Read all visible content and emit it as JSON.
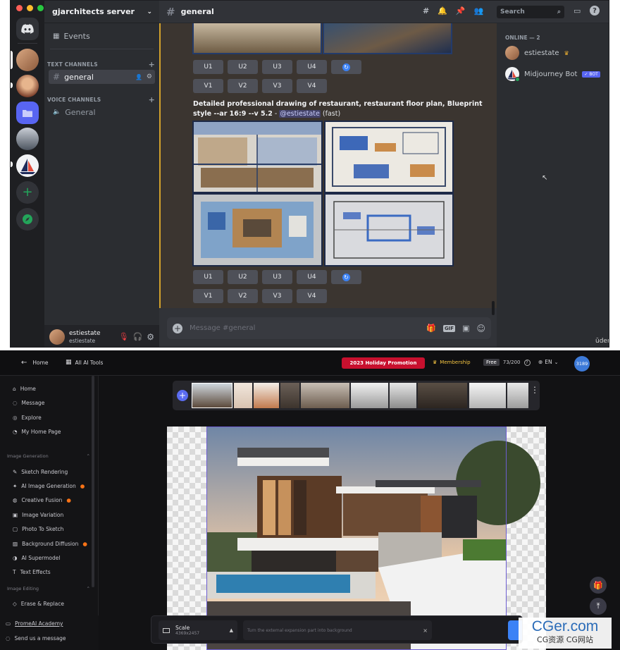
{
  "discord": {
    "server_name": "gjarchitects server",
    "channel_header": "general",
    "search_placeholder": "Search",
    "events_label": "Events",
    "text_channels_label": "TEXT CHANNELS",
    "voice_channels_label": "VOICE CHANNELS",
    "text_channel": "general",
    "voice_channel": "General",
    "upscale_buttons": [
      "U1",
      "U2",
      "U3",
      "U4"
    ],
    "variation_buttons": [
      "V1",
      "V2",
      "V3",
      "V4"
    ],
    "prompt_bold": "Detailed professional drawing of restaurant, restaurant floor plan, Blueprint style --ar 16:9 --v 5.2",
    "prompt_sep": " - ",
    "prompt_mention": "@estiestate",
    "prompt_mode": " (fast)",
    "message_placeholder": "Message #general",
    "members_header": "ONLINE — 2",
    "members": [
      "estiestate",
      "Midjourney Bot"
    ],
    "bot_badge": "✓ BOT",
    "user_name": "estiestate",
    "user_tag": "estiestate",
    "watermark": "ūdemy",
    "gif_label": "GIF",
    "colors": {
      "bg": "#313338",
      "sidebar": "#2b2d31",
      "accent": "#5865f2",
      "highlight_border": "#d3a22c"
    }
  },
  "prome": {
    "home_link": "Home",
    "all_tools": "All AI Tools",
    "promo": "2023 Holiday Promotion",
    "membership": "Membership",
    "plan_badge": "Free",
    "credits": "73/200",
    "language": "EN",
    "user_badge": "3189",
    "nav": [
      "Home",
      "Message",
      "Explore",
      "My Home Page"
    ],
    "image_generation_label": "Image Generation",
    "image_generation": [
      "Sketch Rendering",
      "AI Image Generation",
      "Creative Fusion",
      "Image Variation",
      "Photo To Sketch",
      "Background Diffusion",
      "AI Supermodel",
      "Text Effects"
    ],
    "hot_items": [
      false,
      true,
      true,
      false,
      false,
      true,
      false,
      false
    ],
    "image_editing_label": "Image Editing",
    "image_editing": [
      "Erase & Replace"
    ],
    "academy": "PromeAI Academy",
    "send_message": "Send us a message",
    "scale_label": "Scale",
    "scale_value": "4369x2457",
    "expansion_placeholder": "Turn the external expansion part into background",
    "colors": {
      "bg": "#121214",
      "promo": "#c8102e",
      "accent": "#3b82f6"
    }
  },
  "cg_watermark": {
    "line1": "CGer.com",
    "line2": "CG资源 CG网站"
  }
}
